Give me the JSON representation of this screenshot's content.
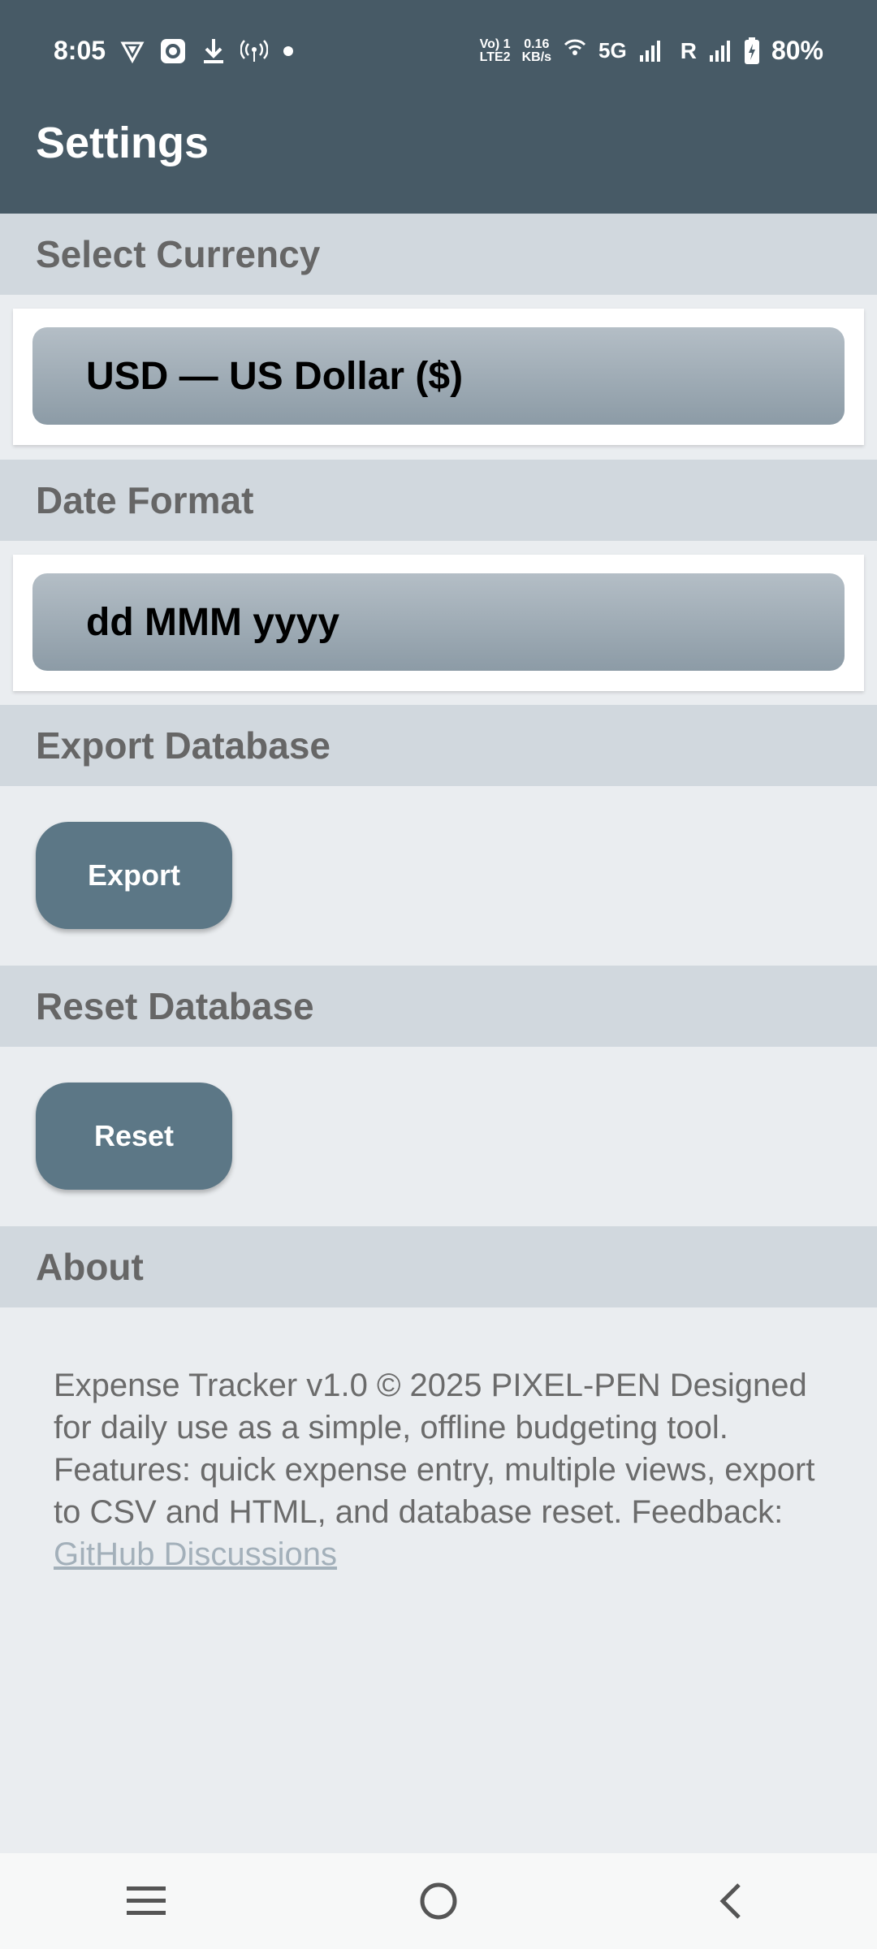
{
  "status_bar": {
    "time": "8:05",
    "net_speed_value": "0.16",
    "net_speed_unit": "KB/s",
    "volte_top": "Vo) 1",
    "volte_bottom": "LTE2",
    "network": "5G",
    "roaming": "R",
    "battery": "80%"
  },
  "app_bar": {
    "title": "Settings"
  },
  "sections": {
    "currency": {
      "header": "Select Currency",
      "selected": "USD — US Dollar ($)"
    },
    "date_format": {
      "header": "Date Format",
      "selected": "dd MMM yyyy"
    },
    "export": {
      "header": "Export Database",
      "button": "Export"
    },
    "reset": {
      "header": "Reset Database",
      "button": "Reset"
    },
    "about": {
      "header": "About",
      "text": "Expense Tracker v1.0 © 2025 PIXEL-PEN Designed for daily use as a simple, offline budgeting tool. Features: quick expense entry, multiple views, export to CSV and HTML, and database reset. Feedback: ",
      "link": "GitHub Discussions"
    }
  },
  "nav_bar": {
    "icons": [
      "menu-icon",
      "home-circle-icon",
      "back-chevron-icon"
    ]
  },
  "colors": {
    "app_bar": "#475a66",
    "section_header": "#d1d8de",
    "button": "#5c7786",
    "background": "#eaedf0"
  }
}
